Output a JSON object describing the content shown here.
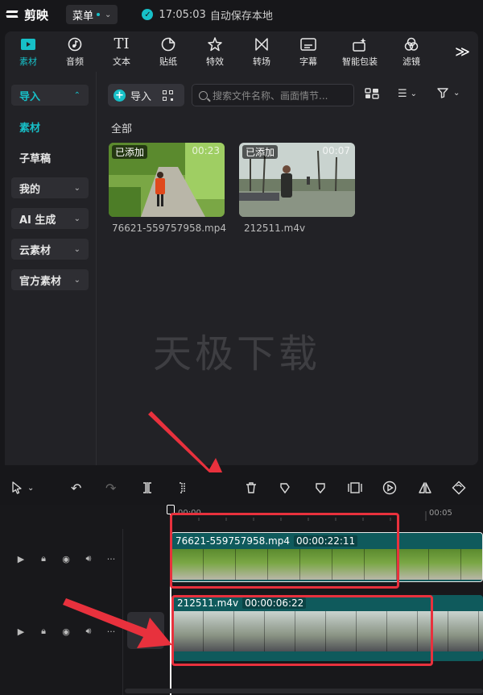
{
  "app": {
    "logo_text": "剪映",
    "menu_label": "菜单",
    "save_time": "17:05:03",
    "save_status": "自动保存本地"
  },
  "toolbar": {
    "tabs": [
      {
        "label": "素材",
        "icon": "media-icon",
        "active": true
      },
      {
        "label": "音频",
        "icon": "audio-icon"
      },
      {
        "label": "文本",
        "icon": "text-icon",
        "glyph": "TI"
      },
      {
        "label": "贴纸",
        "icon": "sticker-icon"
      },
      {
        "label": "特效",
        "icon": "effects-icon"
      },
      {
        "label": "转场",
        "icon": "transition-icon"
      },
      {
        "label": "字幕",
        "icon": "subtitle-icon"
      },
      {
        "label": "智能包装",
        "icon": "smart-pack-icon"
      },
      {
        "label": "滤镜",
        "icon": "filter-icon"
      }
    ],
    "more_glyph": "≫"
  },
  "sidebar": {
    "items": [
      {
        "label": "导入",
        "selected": true,
        "expandable": true
      },
      {
        "label": "素材",
        "selected": true
      },
      {
        "label": "子草稿"
      },
      {
        "label": "我的",
        "expandable": true
      },
      {
        "label": "AI 生成",
        "expandable": true
      },
      {
        "label": "云素材",
        "expandable": true
      },
      {
        "label": "官方素材",
        "expandable": true
      }
    ]
  },
  "media": {
    "import_label": "导入",
    "search_placeholder": "搜索文件名称、画面情节...",
    "section_label": "全部",
    "items": [
      {
        "tag": "已添加",
        "duration": "00:23",
        "filename": "76621-559757958.mp4"
      },
      {
        "tag": "已添加",
        "duration": "00:07",
        "filename": "212511.m4v"
      }
    ],
    "watermark": "天极下载"
  },
  "timeline": {
    "ruler": [
      "00:00",
      "00:05"
    ],
    "tracks": [
      {
        "clip_name": "76621-559757958.mp4",
        "clip_duration": "00:00:22:11"
      },
      {
        "clip_name": "212511.m4v",
        "clip_duration": "00:00:06:22"
      }
    ]
  },
  "colors": {
    "accent": "#17c0c8",
    "clip": "#0f5a5c",
    "highlight": "#e8313d"
  }
}
